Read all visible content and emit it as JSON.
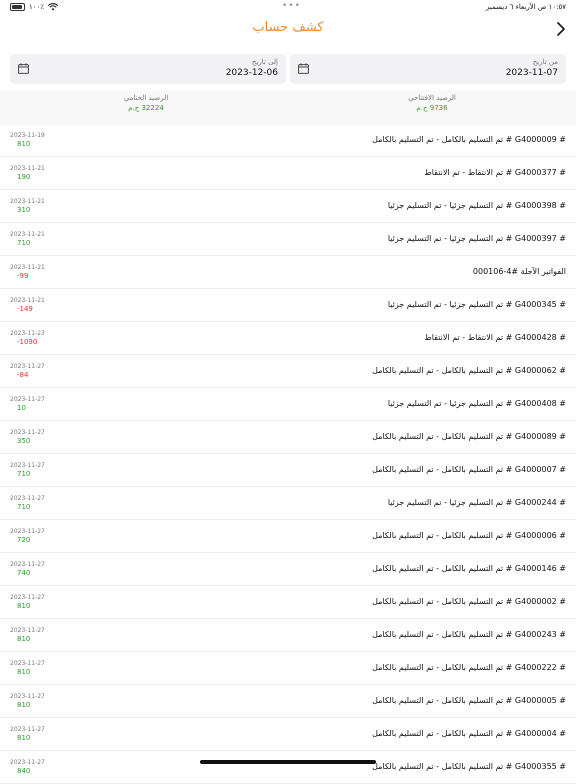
{
  "status_bar": {
    "time": "١٠:٥٧ ص",
    "date": "الأربعاء ٦ ديسمبر",
    "battery": "١٠٠٪",
    "dots": "•••"
  },
  "header": {
    "title": "كشف حساب"
  },
  "from_date": {
    "label": "من تاريخ",
    "value": "2023-11-07"
  },
  "to_date": {
    "label": "إلى تاريخ",
    "value": "2023-12-06"
  },
  "opening_balance": {
    "label": "الرصيد الافتتاحي",
    "value": "9736 ج.م"
  },
  "closing_balance": {
    "label": "الرصيد الختامي",
    "value": "32224 ج.م"
  },
  "colors": {
    "accent": "#ee8a2b",
    "positive": "#2f9a2f",
    "negative": "#d8342c"
  },
  "transactions": [
    {
      "desc": "# G4000009 # تم التسليم بالكامل - تم التسليم بالكامل",
      "date": "2023-11-19",
      "amount": "810"
    },
    {
      "desc": "# G4000377 # تم الانتقاط - تم الانتقاط",
      "date": "2023-11-21",
      "amount": "190"
    },
    {
      "desc": "# G4000398 # تم التسليم جزئيا - تم التسليم جزئيا",
      "date": "2023-11-21",
      "amount": "310"
    },
    {
      "desc": "# G4000397 # تم التسليم جزئيا - تم التسليم جزئيا",
      "date": "2023-11-21",
      "amount": "710"
    },
    {
      "desc": "الفواتير الآجلة #4-000106",
      "date": "2023-11-21",
      "amount": "-99"
    },
    {
      "desc": "# G4000345 # تم التسليم جزئيا - تم التسليم جزئيا",
      "date": "2023-11-21",
      "amount": "-149"
    },
    {
      "desc": "# G4000428 # تم الانتقاط - تم الانتقاط",
      "date": "2023-11-23",
      "amount": "-1090"
    },
    {
      "desc": "# G4000062 # تم التسليم بالكامل - تم التسليم بالكامل",
      "date": "2023-11-27",
      "amount": "-84"
    },
    {
      "desc": "# G4000408 # تم التسليم جزئيا - تم التسليم جزئيا",
      "date": "2023-11-27",
      "amount": "10"
    },
    {
      "desc": "# G4000089 # تم التسليم بالكامل - تم التسليم بالكامل",
      "date": "2023-11-27",
      "amount": "350"
    },
    {
      "desc": "# G4000007 # تم التسليم بالكامل - تم التسليم بالكامل",
      "date": "2023-11-27",
      "amount": "710"
    },
    {
      "desc": "# G4000244 # تم التسليم جزئيا - تم التسليم جزئيا",
      "date": "2023-11-27",
      "amount": "710"
    },
    {
      "desc": "# G4000006 # تم التسليم بالكامل - تم التسليم بالكامل",
      "date": "2023-11-27",
      "amount": "720"
    },
    {
      "desc": "# G4000146 # تم التسليم بالكامل - تم التسليم بالكامل",
      "date": "2023-11-27",
      "amount": "740"
    },
    {
      "desc": "# G4000002 # تم التسليم بالكامل - تم التسليم بالكامل",
      "date": "2023-11-27",
      "amount": "810"
    },
    {
      "desc": "# G4000243 # تم التسليم بالكامل - تم التسليم بالكامل",
      "date": "2023-11-27",
      "amount": "810"
    },
    {
      "desc": "# G4000222 # تم التسليم بالكامل - تم التسليم بالكامل",
      "date": "2023-11-27",
      "amount": "810"
    },
    {
      "desc": "# G4000005 # تم التسليم بالكامل - تم التسليم بالكامل",
      "date": "2023-11-27",
      "amount": "810"
    },
    {
      "desc": "# G4000004 # تم التسليم بالكامل - تم التسليم بالكامل",
      "date": "2023-11-27",
      "amount": "810"
    },
    {
      "desc": "# G4000355 # تم التسليم بالكامل - تم التسليم بالكامل",
      "date": "2023-11-27",
      "amount": "840"
    }
  ]
}
